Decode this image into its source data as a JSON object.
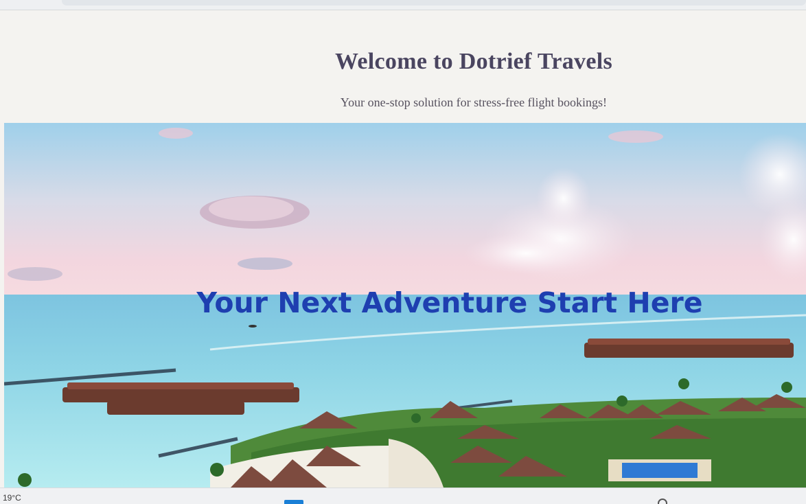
{
  "header": {
    "title": "Welcome to Dotrief Travels",
    "tagline": "Your one-stop solution for stress-free flight bookings!"
  },
  "hero": {
    "headline": "Your Next Adventure Start Here",
    "headline_color": "#1e3fb0",
    "image_subject": "tropical-resort-beach-scene"
  },
  "taskbar": {
    "weather_temp": "19°C",
    "start_icon": "windows-start-icon",
    "tray_icon": "wifi-icon"
  }
}
